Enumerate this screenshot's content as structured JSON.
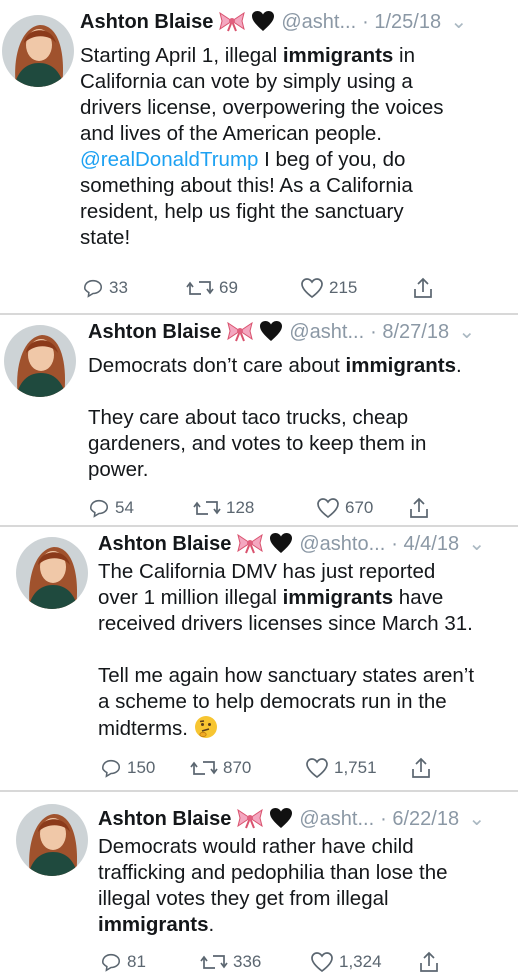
{
  "author": {
    "name": "Ashton Blaise"
  },
  "tweets": [
    {
      "handle": "@asht...",
      "date": "· 1/25/18",
      "lines": [
        [
          {
            "t": "Starting April 1, illegal "
          },
          {
            "t": "immigrants",
            "b": true
          },
          {
            "t": " in"
          }
        ],
        [
          {
            "t": "California can vote by simply using a"
          }
        ],
        [
          {
            "t": "drivers license, overpowering the voices"
          }
        ],
        [
          {
            "t": "and lives of the American people."
          }
        ],
        [
          {
            "t": "@realDonaldTrump",
            "m": true
          },
          {
            "t": " I beg of you, do"
          }
        ],
        [
          {
            "t": "something about this! As a California"
          }
        ],
        [
          {
            "t": "resident, help us fight the sanctuary"
          }
        ],
        [
          {
            "t": "state!"
          }
        ]
      ],
      "replies": "33",
      "retweets": "69",
      "likes": "215"
    },
    {
      "handle": "@asht...",
      "date": "· 8/27/18",
      "lines": [
        [
          {
            "t": "Democrats don’t care about "
          },
          {
            "t": "immigrants",
            "b": true
          },
          {
            "t": "."
          }
        ],
        [
          {
            "t": ""
          }
        ],
        [
          {
            "t": "They care about taco trucks, cheap"
          }
        ],
        [
          {
            "t": "gardeners, and votes to keep them in"
          }
        ],
        [
          {
            "t": "power."
          }
        ]
      ],
      "replies": "54",
      "retweets": "128",
      "likes": "670"
    },
    {
      "handle": "@ashto...",
      "date": "· 4/4/18",
      "lines": [
        [
          {
            "t": "The California DMV has just reported"
          }
        ],
        [
          {
            "t": "over 1 million illegal "
          },
          {
            "t": "immigrants",
            "b": true
          },
          {
            "t": " have"
          }
        ],
        [
          {
            "t": "received drivers licenses since March 31."
          }
        ],
        [
          {
            "t": ""
          }
        ],
        [
          {
            "t": "Tell me again how sanctuary states aren’t"
          }
        ],
        [
          {
            "t": "a scheme to help democrats run in the"
          }
        ],
        [
          {
            "t": "midterms. "
          },
          {
            "t": "thinking-face-emoji",
            "e": true
          }
        ]
      ],
      "replies": "150",
      "retweets": "870",
      "likes": "1,751"
    },
    {
      "handle": "@asht...",
      "date": "· 6/22/18",
      "lines": [
        [
          {
            "t": "Democrats would rather have child"
          }
        ],
        [
          {
            "t": "trafficking and pedophilia than lose the"
          }
        ],
        [
          {
            "t": "illegal votes they get from illegal"
          }
        ],
        [
          {
            "t": "immigrants",
            "b": true
          },
          {
            "t": "."
          }
        ]
      ],
      "replies": "81",
      "retweets": "336",
      "likes": "1,324"
    }
  ],
  "colors": {
    "link": "#1da1f2",
    "meta": "#8b98a5",
    "icon": "#5b6670"
  },
  "icons": [
    "ribbon-emoji",
    "black-heart-emoji",
    "chevron-down-icon",
    "reply-icon",
    "retweet-icon",
    "like-icon",
    "share-icon"
  ]
}
